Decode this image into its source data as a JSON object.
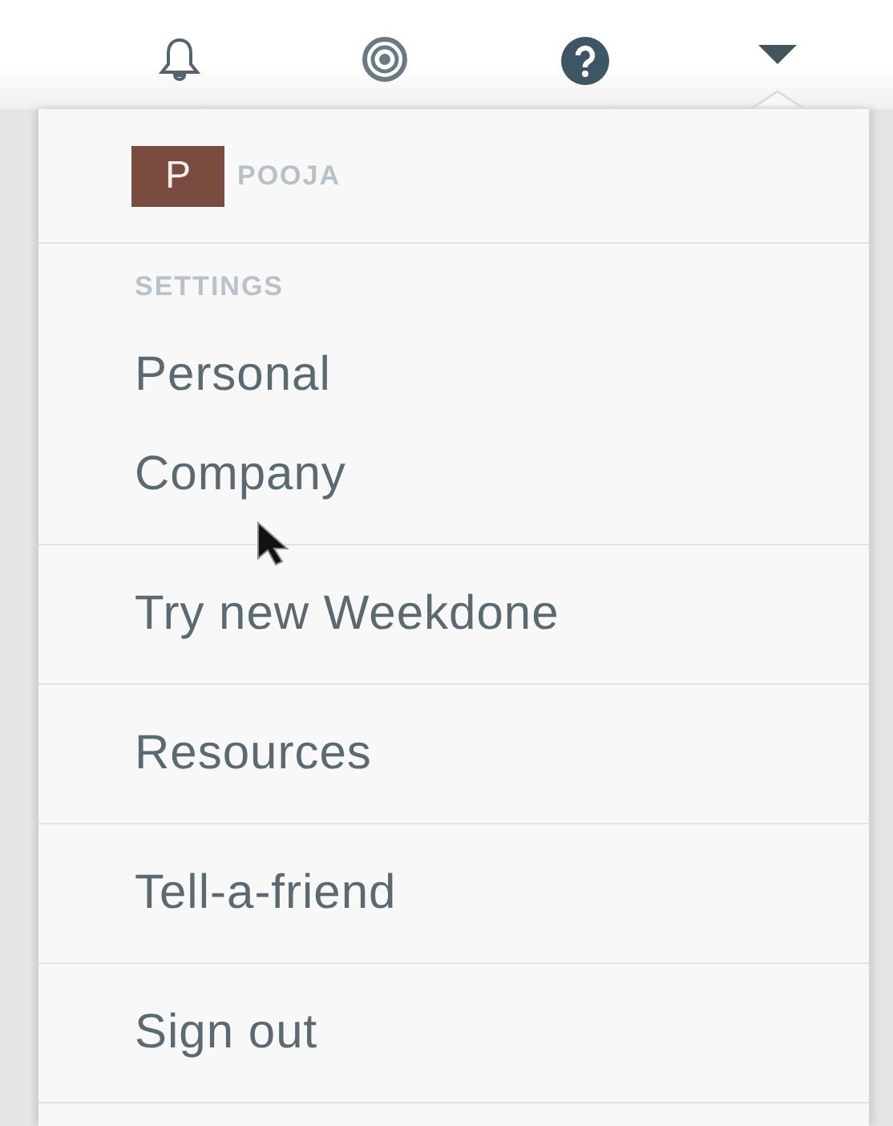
{
  "user": {
    "initial": "P",
    "name": "POOJA"
  },
  "menu": {
    "section_heading": "SETTINGS",
    "groups": [
      [
        "Personal",
        "Company"
      ],
      [
        "Try new Weekdone"
      ],
      [
        "Resources"
      ],
      [
        "Tell-a-friend"
      ],
      [
        "Sign out"
      ]
    ]
  }
}
